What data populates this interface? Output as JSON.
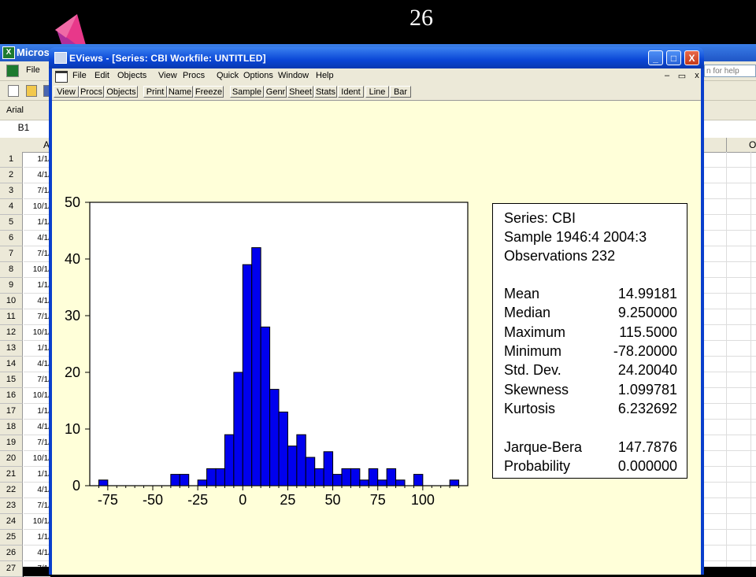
{
  "slide_number": "26",
  "excel": {
    "title": "Micros",
    "menu_file": "File",
    "help_box": "n for help",
    "font_name": "Arial",
    "name_box": "B1",
    "col_a": "A",
    "col_o": "O",
    "rows": [
      {
        "n": "1",
        "v": "1/1/"
      },
      {
        "n": "2",
        "v": "4/1/"
      },
      {
        "n": "3",
        "v": "7/1/"
      },
      {
        "n": "4",
        "v": "10/1/"
      },
      {
        "n": "5",
        "v": "1/1/"
      },
      {
        "n": "6",
        "v": "4/1/"
      },
      {
        "n": "7",
        "v": "7/1/"
      },
      {
        "n": "8",
        "v": "10/1/"
      },
      {
        "n": "9",
        "v": "1/1/"
      },
      {
        "n": "10",
        "v": "4/1/"
      },
      {
        "n": "11",
        "v": "7/1/"
      },
      {
        "n": "12",
        "v": "10/1/"
      },
      {
        "n": "13",
        "v": "1/1/"
      },
      {
        "n": "14",
        "v": "4/1/"
      },
      {
        "n": "15",
        "v": "7/1/"
      },
      {
        "n": "16",
        "v": "10/1/"
      },
      {
        "n": "17",
        "v": "1/1/"
      },
      {
        "n": "18",
        "v": "4/1/"
      },
      {
        "n": "19",
        "v": "7/1/"
      },
      {
        "n": "20",
        "v": "10/1/"
      },
      {
        "n": "21",
        "v": "1/1/"
      },
      {
        "n": "22",
        "v": "4/1/"
      },
      {
        "n": "23",
        "v": "7/1/"
      },
      {
        "n": "24",
        "v": "10/1/"
      },
      {
        "n": "25",
        "v": "1/1/"
      },
      {
        "n": "26",
        "v": "4/1/"
      },
      {
        "n": "27",
        "v": "7/1/"
      }
    ]
  },
  "eviews": {
    "title": "EViews - [Series: CBI   Workfile: UNTITLED]",
    "menu": [
      "File",
      "Edit",
      "Objects",
      "View",
      "Procs",
      "Quick",
      "Options",
      "Window",
      "Help"
    ],
    "toolbar": [
      "View",
      "Procs",
      "Objects",
      "Print",
      "Name",
      "Freeze",
      "Sample",
      "Genr",
      "Sheet",
      "Stats",
      "Ident",
      "Line",
      "Bar"
    ],
    "window_controls": {
      "minimize": "_",
      "maximize": "□",
      "close": "X"
    },
    "child_controls": {
      "minimize": "–",
      "restore": "▭",
      "close": "x"
    }
  },
  "stats": {
    "series": "Series: CBI",
    "sample": "Sample 1946:4 2004:3",
    "observations": "Observations 232",
    "rows": [
      {
        "label": "Mean",
        "value": "14.99181"
      },
      {
        "label": "Median",
        "value": "9.250000"
      },
      {
        "label": "Maximum",
        "value": "115.5000"
      },
      {
        "label": "Minimum",
        "value": "-78.20000"
      },
      {
        "label": "Std. Dev.",
        "value": "24.20040"
      },
      {
        "label": "Skewness",
        "value": "1.099781"
      },
      {
        "label": "Kurtosis",
        "value": "6.232692"
      }
    ],
    "jb_label": "Jarque-Bera",
    "jb_value": "147.7876",
    "prob_label": "Probability",
    "prob_value": "0.000000"
  },
  "chart_data": {
    "type": "bar",
    "bar_color": "#0000ee",
    "bin_width": 5,
    "bins_left_edges": [
      -80,
      -75,
      -70,
      -65,
      -60,
      -55,
      -50,
      -45,
      -40,
      -35,
      -30,
      -25,
      -20,
      -15,
      -10,
      -5,
      0,
      5,
      10,
      15,
      20,
      25,
      30,
      35,
      40,
      45,
      50,
      55,
      60,
      65,
      70,
      75,
      80,
      85,
      90,
      95,
      100,
      105,
      110,
      115
    ],
    "values": [
      1,
      0,
      0,
      0,
      0,
      0,
      0,
      0,
      2,
      2,
      0,
      1,
      3,
      3,
      9,
      20,
      39,
      42,
      28,
      17,
      13,
      7,
      9,
      5,
      3,
      6,
      2,
      3,
      3,
      1,
      3,
      1,
      3,
      1,
      0,
      2,
      0,
      0,
      0,
      1
    ],
    "xlim": [
      -85,
      125
    ],
    "ylim": [
      0,
      50
    ],
    "xticks": [
      -75,
      -50,
      -25,
      0,
      25,
      50,
      75,
      100
    ],
    "yticks": [
      0,
      10,
      20,
      30,
      40,
      50
    ],
    "xlabel": "",
    "ylabel": "",
    "grid": false
  }
}
